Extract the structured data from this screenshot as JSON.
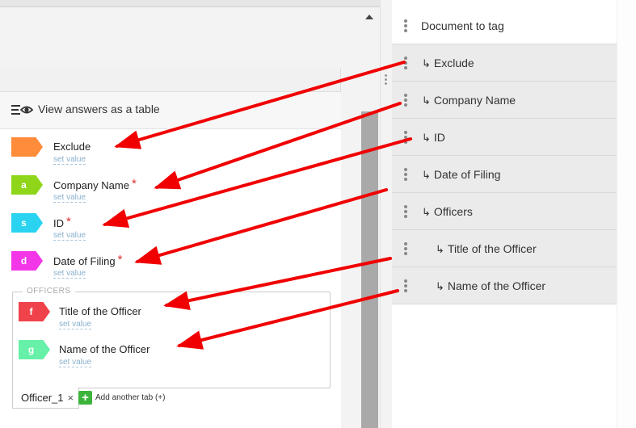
{
  "form": {
    "view_table_label": "View answers as a table",
    "set_value_label": "set value",
    "fields": [
      {
        "key": "Exclude",
        "label": "Exclude",
        "tag_letter": "",
        "color": "#ff8c3b",
        "required": false
      },
      {
        "key": "Company Name",
        "label": "Company Name",
        "tag_letter": "a",
        "color": "#8fd61a",
        "required": true
      },
      {
        "key": "ID",
        "label": "ID",
        "tag_letter": "s",
        "color": "#2ad4f0",
        "required": true
      },
      {
        "key": "Date of Filing",
        "label": "Date of Filing",
        "tag_letter": "d",
        "color": "#f236e8",
        "required": true
      }
    ],
    "officers_group": {
      "legend": "OFFICERS",
      "fields": [
        {
          "key": "Title of the Officer",
          "label": "Title of the Officer",
          "tag_letter": "f",
          "color": "#f0424a"
        },
        {
          "key": "Name of the Officer",
          "label": "Name of the Officer",
          "tag_letter": "g",
          "color": "#66f0a8"
        }
      ]
    },
    "tab": {
      "label": "Officer_1",
      "close": "×"
    },
    "add_tab": {
      "icon": "+",
      "label": "Add another tab (+)"
    },
    "required_mark": "*"
  },
  "tree": {
    "root": {
      "label": "Document to tag"
    },
    "arrow_glyph": "↳",
    "items": [
      {
        "label": "Exclude",
        "level": 1
      },
      {
        "label": "Company Name",
        "level": 1
      },
      {
        "label": "ID",
        "level": 1
      },
      {
        "label": "Date of Filing",
        "level": 1
      },
      {
        "label": "Officers",
        "level": 1
      },
      {
        "label": "Title of the Officer",
        "level": 2
      },
      {
        "label": "Name of the Officer",
        "level": 2
      }
    ]
  },
  "colors": {
    "arrow": "#f00000",
    "accent_green": "#3cb43c",
    "scrollbar": "#a9a9a9"
  }
}
